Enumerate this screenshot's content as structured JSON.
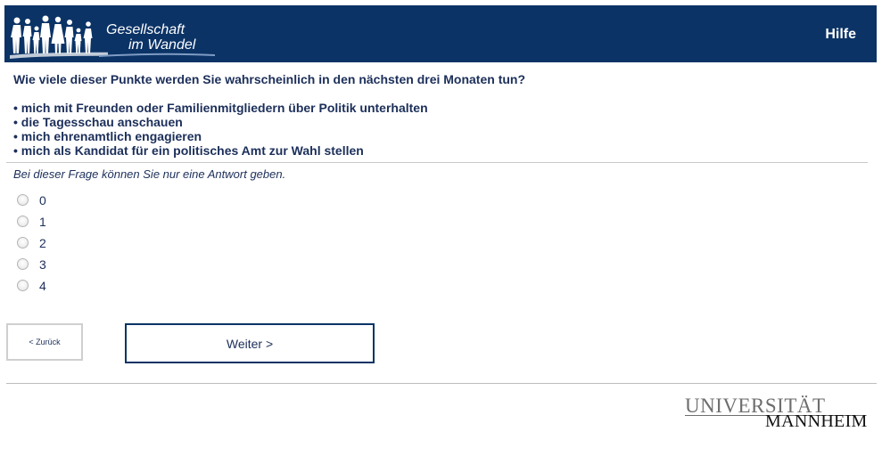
{
  "header": {
    "logo_line1": "Gesellschaft",
    "logo_line2": "im Wandel",
    "help_label": "Hilfe",
    "bg_color": "#0b3366"
  },
  "question": {
    "text": "Wie viele dieser Punkte werden Sie wahrscheinlich in den nächsten drei Monaten tun?",
    "items": [
      "mich mit Freunden oder Familienmitgliedern über Politik unterhalten",
      "die Tagesschau anschauen",
      "mich ehrenamtlich engagieren",
      "mich als Kandidat für ein politisches Amt zur Wahl stellen"
    ],
    "instruction": "Bei dieser Frage können Sie nur eine Antwort geben."
  },
  "options": [
    "0",
    "1",
    "2",
    "3",
    "4"
  ],
  "nav": {
    "back_label": "< Zurück",
    "next_label": "Weiter >"
  },
  "footer": {
    "uni_line1": "UNIVERSITÄT",
    "uni_line2": "MANNHEIM"
  }
}
